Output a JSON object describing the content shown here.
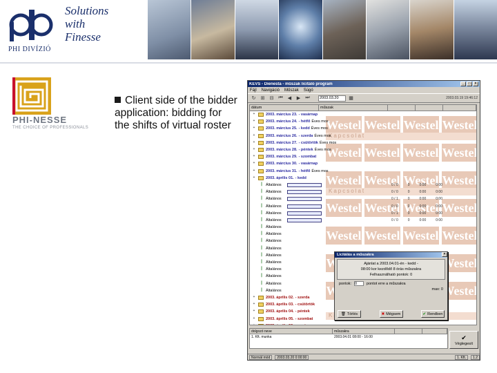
{
  "slide": {
    "company_sub": "PHI DIVÍZIÓ",
    "tagline_lines": [
      "Solutions",
      "with",
      "Finesse"
    ],
    "brand_name": "PHI-NESSE",
    "brand_sub": "THE CHOICE OF PROFESSIONALS",
    "bullet": "Client side of the bidder application: bidding for the shifts of virtual roster"
  },
  "colors": {
    "brand_blue": "#1a2f6b",
    "titlebar": "#0a246a",
    "watermark": "#e8c9b7",
    "logo_gold": "#d9a21b",
    "logo_red": "#c8102e"
  },
  "app": {
    "title": "KEVS - Dienesta - műszak licitáló program",
    "menu": [
      "Fájl",
      "Navigáció",
      "Műszak",
      "Súgó"
    ],
    "date_field": "2003.03.20",
    "toolbar_right": "2003.03.19 19:46:12",
    "columns": [
      "dátum",
      "műszak",
      "",
      "",
      ""
    ],
    "watermark_text": "Westel",
    "watermark_band": "Kapcsolat",
    "day_rows": [
      {
        "date": "2003. március 23.",
        "day": "- vasárnap",
        "note": ""
      },
      {
        "date": "2003. március 24.",
        "day": "- hétfő",
        "note": "Éves mos"
      },
      {
        "date": "2003. március 25.",
        "day": "- kedd",
        "note": "Éves mos"
      },
      {
        "date": "2003. március 26.",
        "day": "- szerda",
        "note": "Éves mos"
      },
      {
        "date": "2003. március 27.",
        "day": "- csütörtök",
        "note": "Éves mos"
      },
      {
        "date": "2003. március 28.",
        "day": "- péntek",
        "note": "Éves mos"
      },
      {
        "date": "2003. március 29.",
        "day": "- szombat",
        "note": ""
      },
      {
        "date": "2003. március 30.",
        "day": "- vasárnap",
        "note": ""
      },
      {
        "date": "2003. március 31.",
        "day": "- hétfő",
        "note": "Éves mos"
      },
      {
        "date": "2003. április 01.",
        "day": "- kedd",
        "note": ""
      }
    ],
    "shift_label": "Általános",
    "shift_rows": [
      {
        "nums": [
          "0 / 0",
          "0",
          "0:00",
          "0:00"
        ]
      },
      {
        "nums": [
          "0 / 0",
          "0",
          "0:00",
          "0:00"
        ]
      },
      {
        "nums": [
          "0 / 1",
          "0",
          "0:00",
          "0:00"
        ]
      },
      {
        "nums": [
          "0 / 0",
          "0",
          "0:00",
          "0:00"
        ]
      },
      {
        "nums": [
          "0 / 1",
          "0",
          "0:00",
          "0:00"
        ]
      },
      {
        "nums": [
          "0 / 0",
          "0",
          "0:00",
          "0:00"
        ]
      }
    ],
    "shift_rows_bottom": 10,
    "tail_rows": [
      {
        "date": "2003. április 02.",
        "day": "- szerda"
      },
      {
        "date": "2003. április 03.",
        "day": "- csütörtök"
      },
      {
        "date": "2003. április 04.",
        "day": "- péntek"
      },
      {
        "date": "2003. április 05.",
        "day": "- szombat"
      },
      {
        "date": "2003. április 06.",
        "day": "- vasárnap"
      }
    ],
    "dialog": {
      "title": "Licitálás a műszakra",
      "line1": "Ajánlat a 2003.04.01-én - kedd -",
      "line2": "08:00 kor kezdődő 8 órás műszakra",
      "line3": "Felhasználható pontok: 0",
      "points_label": "pontok:",
      "points_value": "0",
      "points_suffix": "pontot erre a műszakra",
      "max_label": "max: 0",
      "btn_delete": "Törlés",
      "btn_cancel": "Mégsem",
      "btn_ok": "Rendben"
    },
    "bottom_pane": {
      "headers": [
        "dolgozó neve",
        "műszakra",
        "",
        ""
      ],
      "row": [
        "1. Kft. munka",
        "2003.04.01 08:00 - 16:00",
        "",
        ""
      ]
    },
    "confirm_label": "Véglegesít",
    "status": [
      "Normál mód",
      "2003.03.20 0:00:00",
      "1. Kft.",
      "1.2"
    ]
  }
}
